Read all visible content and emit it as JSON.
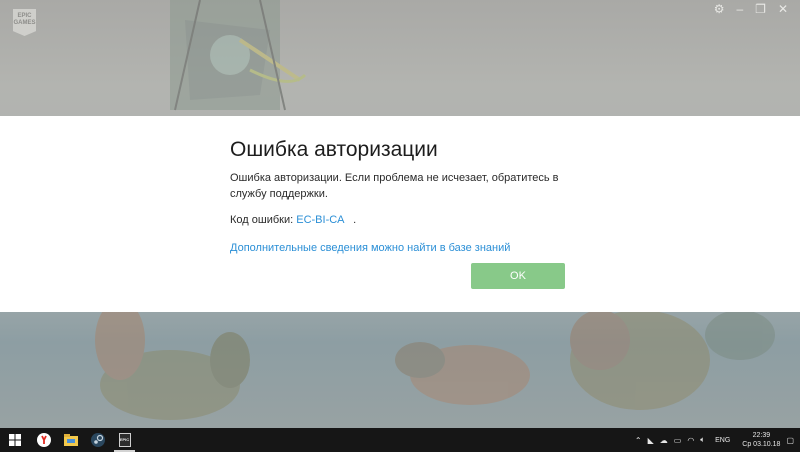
{
  "app": {
    "logo_text": "EPIC GAMES"
  },
  "window_controls": {
    "settings_icon": "gear-icon",
    "minimize_icon": "minimize-icon",
    "maximize_icon": "maximize-icon",
    "close_icon": "close-icon"
  },
  "dialog": {
    "title": "Ошибка авторизации",
    "message": "Ошибка авторизации. Если проблема не исчезает, обратитесь в службу поддержки.",
    "error_label": "Код ошибки:",
    "error_code": "EC-BI-CA",
    "error_suffix": ".",
    "kb_link": "Дополнительные сведения можно найти в базе знаний",
    "ok_label": "OK",
    "ok_color": "#88c989",
    "link_color": "#2b8fd6"
  },
  "taskbar": {
    "start_icon": "windows-icon",
    "apps": [
      {
        "name": "yandex-browser-icon"
      },
      {
        "name": "file-explorer-icon"
      },
      {
        "name": "steam-icon"
      },
      {
        "name": "epic-games-icon",
        "label": "EPIC"
      }
    ],
    "tray": {
      "language": "ENG",
      "time": "22:39",
      "date": "Ср 03.10.18"
    }
  }
}
